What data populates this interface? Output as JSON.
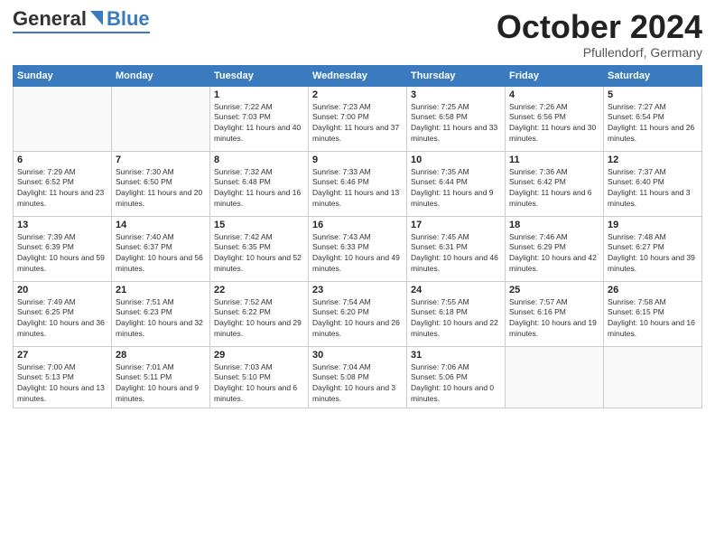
{
  "header": {
    "logo_general": "General",
    "logo_blue": "Blue",
    "month_title": "October 2024",
    "location": "Pfullendorf, Germany"
  },
  "calendar": {
    "days_of_week": [
      "Sunday",
      "Monday",
      "Tuesday",
      "Wednesday",
      "Thursday",
      "Friday",
      "Saturday"
    ],
    "weeks": [
      [
        {
          "day": "",
          "info": ""
        },
        {
          "day": "",
          "info": ""
        },
        {
          "day": "1",
          "info": "Sunrise: 7:22 AM\nSunset: 7:03 PM\nDaylight: 11 hours and 40 minutes."
        },
        {
          "day": "2",
          "info": "Sunrise: 7:23 AM\nSunset: 7:00 PM\nDaylight: 11 hours and 37 minutes."
        },
        {
          "day": "3",
          "info": "Sunrise: 7:25 AM\nSunset: 6:58 PM\nDaylight: 11 hours and 33 minutes."
        },
        {
          "day": "4",
          "info": "Sunrise: 7:26 AM\nSunset: 6:56 PM\nDaylight: 11 hours and 30 minutes."
        },
        {
          "day": "5",
          "info": "Sunrise: 7:27 AM\nSunset: 6:54 PM\nDaylight: 11 hours and 26 minutes."
        }
      ],
      [
        {
          "day": "6",
          "info": "Sunrise: 7:29 AM\nSunset: 6:52 PM\nDaylight: 11 hours and 23 minutes."
        },
        {
          "day": "7",
          "info": "Sunrise: 7:30 AM\nSunset: 6:50 PM\nDaylight: 11 hours and 20 minutes."
        },
        {
          "day": "8",
          "info": "Sunrise: 7:32 AM\nSunset: 6:48 PM\nDaylight: 11 hours and 16 minutes."
        },
        {
          "day": "9",
          "info": "Sunrise: 7:33 AM\nSunset: 6:46 PM\nDaylight: 11 hours and 13 minutes."
        },
        {
          "day": "10",
          "info": "Sunrise: 7:35 AM\nSunset: 6:44 PM\nDaylight: 11 hours and 9 minutes."
        },
        {
          "day": "11",
          "info": "Sunrise: 7:36 AM\nSunset: 6:42 PM\nDaylight: 11 hours and 6 minutes."
        },
        {
          "day": "12",
          "info": "Sunrise: 7:37 AM\nSunset: 6:40 PM\nDaylight: 11 hours and 3 minutes."
        }
      ],
      [
        {
          "day": "13",
          "info": "Sunrise: 7:39 AM\nSunset: 6:39 PM\nDaylight: 10 hours and 59 minutes."
        },
        {
          "day": "14",
          "info": "Sunrise: 7:40 AM\nSunset: 6:37 PM\nDaylight: 10 hours and 56 minutes."
        },
        {
          "day": "15",
          "info": "Sunrise: 7:42 AM\nSunset: 6:35 PM\nDaylight: 10 hours and 52 minutes."
        },
        {
          "day": "16",
          "info": "Sunrise: 7:43 AM\nSunset: 6:33 PM\nDaylight: 10 hours and 49 minutes."
        },
        {
          "day": "17",
          "info": "Sunrise: 7:45 AM\nSunset: 6:31 PM\nDaylight: 10 hours and 46 minutes."
        },
        {
          "day": "18",
          "info": "Sunrise: 7:46 AM\nSunset: 6:29 PM\nDaylight: 10 hours and 42 minutes."
        },
        {
          "day": "19",
          "info": "Sunrise: 7:48 AM\nSunset: 6:27 PM\nDaylight: 10 hours and 39 minutes."
        }
      ],
      [
        {
          "day": "20",
          "info": "Sunrise: 7:49 AM\nSunset: 6:25 PM\nDaylight: 10 hours and 36 minutes."
        },
        {
          "day": "21",
          "info": "Sunrise: 7:51 AM\nSunset: 6:23 PM\nDaylight: 10 hours and 32 minutes."
        },
        {
          "day": "22",
          "info": "Sunrise: 7:52 AM\nSunset: 6:22 PM\nDaylight: 10 hours and 29 minutes."
        },
        {
          "day": "23",
          "info": "Sunrise: 7:54 AM\nSunset: 6:20 PM\nDaylight: 10 hours and 26 minutes."
        },
        {
          "day": "24",
          "info": "Sunrise: 7:55 AM\nSunset: 6:18 PM\nDaylight: 10 hours and 22 minutes."
        },
        {
          "day": "25",
          "info": "Sunrise: 7:57 AM\nSunset: 6:16 PM\nDaylight: 10 hours and 19 minutes."
        },
        {
          "day": "26",
          "info": "Sunrise: 7:58 AM\nSunset: 6:15 PM\nDaylight: 10 hours and 16 minutes."
        }
      ],
      [
        {
          "day": "27",
          "info": "Sunrise: 7:00 AM\nSunset: 5:13 PM\nDaylight: 10 hours and 13 minutes."
        },
        {
          "day": "28",
          "info": "Sunrise: 7:01 AM\nSunset: 5:11 PM\nDaylight: 10 hours and 9 minutes."
        },
        {
          "day": "29",
          "info": "Sunrise: 7:03 AM\nSunset: 5:10 PM\nDaylight: 10 hours and 6 minutes."
        },
        {
          "day": "30",
          "info": "Sunrise: 7:04 AM\nSunset: 5:08 PM\nDaylight: 10 hours and 3 minutes."
        },
        {
          "day": "31",
          "info": "Sunrise: 7:06 AM\nSunset: 5:06 PM\nDaylight: 10 hours and 0 minutes."
        },
        {
          "day": "",
          "info": ""
        },
        {
          "day": "",
          "info": ""
        }
      ]
    ]
  }
}
